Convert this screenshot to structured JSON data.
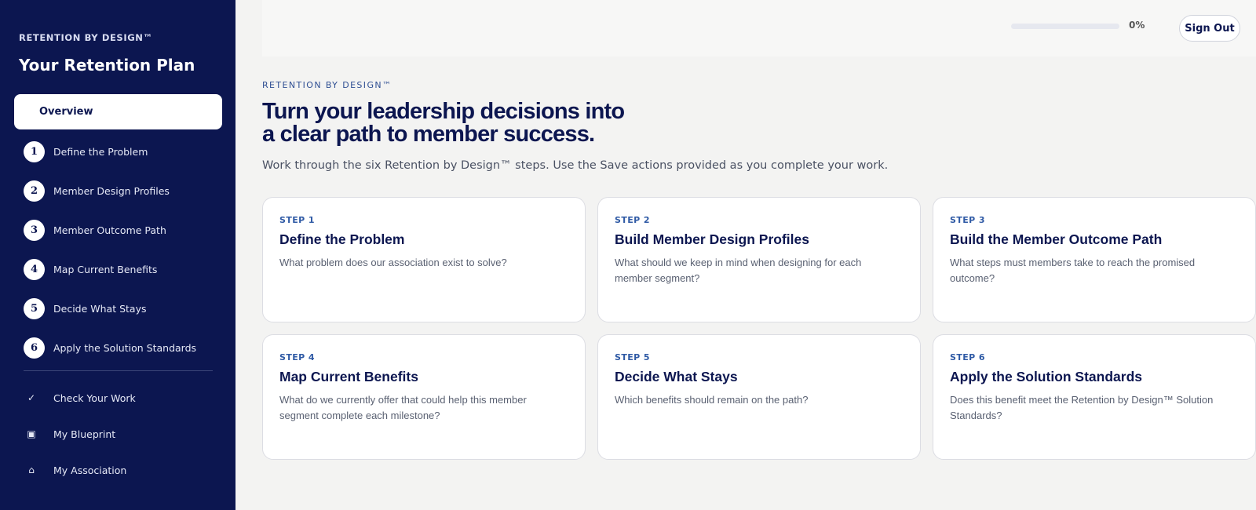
{
  "sidebar": {
    "brand": "RETENTION BY DESIGN™",
    "title": "Your Retention Plan",
    "overview_label": "Overview",
    "steps": [
      {
        "num": "1",
        "label": "Define the Problem"
      },
      {
        "num": "2",
        "label": "Member Design Profiles"
      },
      {
        "num": "3",
        "label": "Member Outcome Path"
      },
      {
        "num": "4",
        "label": "Map Current Benefits"
      },
      {
        "num": "5",
        "label": "Decide What Stays"
      },
      {
        "num": "6",
        "label": "Apply the Solution Standards"
      }
    ],
    "utilities": [
      {
        "icon": "✓",
        "icon_name": "check-icon",
        "label": "Check Your Work"
      },
      {
        "icon": "▣",
        "icon_name": "blueprint-icon",
        "label": "My Blueprint"
      },
      {
        "icon": "⌂",
        "icon_name": "home-icon",
        "label": "My Association"
      }
    ]
  },
  "header": {
    "progress_value": 0,
    "progress_text": "0%",
    "signout_label": "Sign Out"
  },
  "main": {
    "eyebrow": "RETENTION BY DESIGN™",
    "headline_line1": "Turn your leadership decisions into",
    "headline_line2": "a clear path to member success.",
    "subtext": "Work through the six Retention by Design™ steps. Use the Save actions provided as you complete your work.",
    "cards": [
      {
        "step": "STEP 1",
        "title": "Define the Problem",
        "desc": "What problem does our association exist to solve?"
      },
      {
        "step": "STEP 2",
        "title": "Build Member Design Profiles",
        "desc": "What should we keep in mind when designing for each member segment?"
      },
      {
        "step": "STEP 3",
        "title": "Build the Member Outcome Path",
        "desc": "What steps must members take to reach the promised outcome?"
      },
      {
        "step": "STEP 4",
        "title": "Map Current Benefits",
        "desc": "What do we currently offer that could help this member segment complete each milestone?"
      },
      {
        "step": "STEP 5",
        "title": "Decide What Stays",
        "desc": "Which benefits should remain on the path?"
      },
      {
        "step": "STEP 6",
        "title": "Apply the Solution Standards",
        "desc": "Does this benefit meet the Retention by Design™ Solution Standards?"
      }
    ]
  },
  "colors": {
    "sidebar_bg": "#0c1650",
    "accent": "#2f5aa5",
    "page_bg": "#f3f3f2"
  }
}
